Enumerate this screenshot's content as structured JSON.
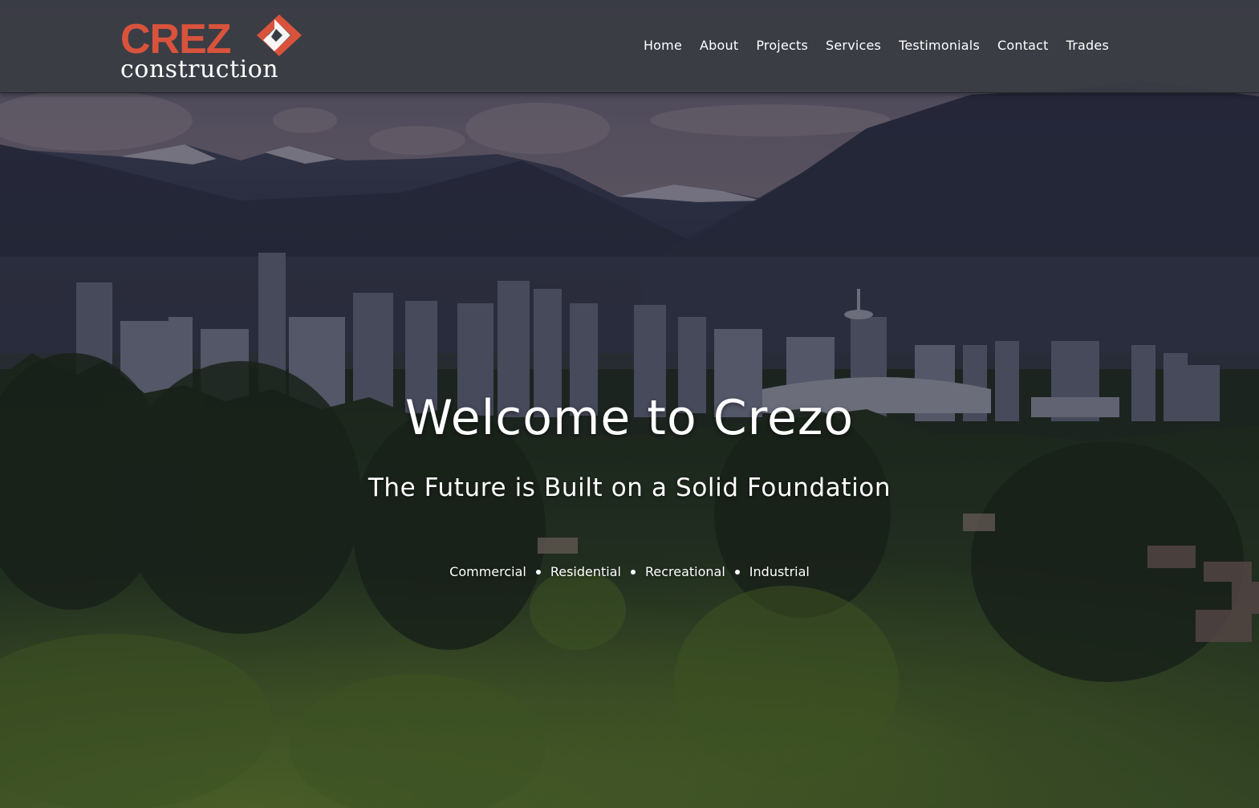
{
  "brand": {
    "logo_word": "CREZ",
    "logo_subword": "construction",
    "primary_color": "#d9533c",
    "text_color": "#ffffff"
  },
  "nav": {
    "items": [
      {
        "label": "Home"
      },
      {
        "label": "About"
      },
      {
        "label": "Projects"
      },
      {
        "label": "Services"
      },
      {
        "label": "Testimonials"
      },
      {
        "label": "Contact"
      },
      {
        "label": "Trades"
      }
    ]
  },
  "hero": {
    "title": "Welcome to Crezo",
    "subtitle": "The Future is Built on a Solid Foundation",
    "sectors": [
      "Commercial",
      "Residential",
      "Recreational",
      "Industrial"
    ],
    "background": "city-skyline-mountains-forest-photo"
  }
}
